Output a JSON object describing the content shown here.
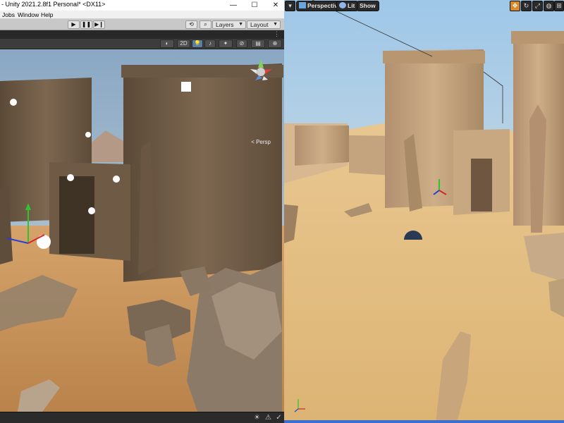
{
  "unity": {
    "window_title": "- Unity 2021.2.8f1 Personal* <DX11>",
    "window_controls": {
      "minimize": "—",
      "maximize": "☐",
      "close": "✕"
    },
    "menu": [
      "Jobs",
      "Window",
      "Help"
    ],
    "toolbar": {
      "play": "▶",
      "pause": "❚❚",
      "step": "▶❙",
      "history": "⟲",
      "search": "⌕",
      "layers": "Layers",
      "layout": "Layout"
    },
    "scene_toolbar": {
      "mode_2d": "2D",
      "menu": "⋮",
      "more": "⋮"
    },
    "gizmo_label": "< Persp"
  },
  "unreal": {
    "perspective_label": "Perspective",
    "lit_label": "Lit",
    "show_label": "Show"
  },
  "colors": {
    "unity_chrome": "#383838",
    "unity_toolbar": "#c8c8c8",
    "sky": "#bcd6ea",
    "sand": "#e2bd7c",
    "stone": "#a98a62",
    "ue_toolbar": "#2a2a2a",
    "ue_active": "#d88a2a",
    "taskbar_blue": "#3a6fcf"
  },
  "icons": {
    "light": "sun-icon",
    "gizmo": "scene-orientation-gizmo",
    "eye": "eye-icon",
    "gear": "gear-icon",
    "transform": "move-icon"
  }
}
